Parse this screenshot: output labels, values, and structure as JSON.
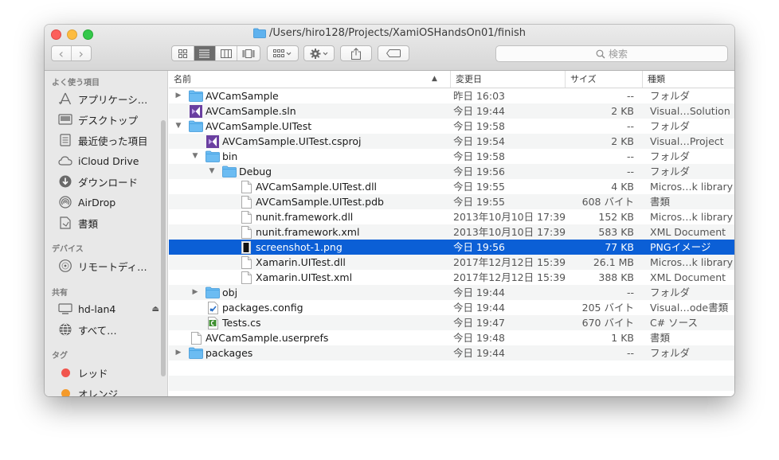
{
  "window": {
    "title": "/Users/hiro128/Projects/XamiOSHandsOn01/finish"
  },
  "toolbar": {
    "back": "‹",
    "forward": "›",
    "search_placeholder": "検索"
  },
  "sidebar": {
    "favorites_header": "よく使う項目",
    "favorites": [
      {
        "label": "アプリケーシ…",
        "icon": "applications-icon"
      },
      {
        "label": "デスクトップ",
        "icon": "desktop-icon"
      },
      {
        "label": "最近使った項目",
        "icon": "recents-icon"
      },
      {
        "label": "iCloud Drive",
        "icon": "cloud-icon"
      },
      {
        "label": "ダウンロード",
        "icon": "downloads-icon"
      },
      {
        "label": "AirDrop",
        "icon": "airdrop-icon"
      },
      {
        "label": "書類",
        "icon": "documents-icon"
      }
    ],
    "devices_header": "デバイス",
    "devices": [
      {
        "label": "リモートディ…",
        "icon": "disc-icon"
      }
    ],
    "shared_header": "共有",
    "shared": [
      {
        "label": "hd-lan4",
        "icon": "computer-icon"
      },
      {
        "label": "すべて…",
        "icon": "network-icon"
      }
    ],
    "tags_header": "タグ",
    "tags": [
      {
        "label": "レッド",
        "color": "#f1554d"
      },
      {
        "label": "オレンジ",
        "color": "#f49a2b"
      }
    ]
  },
  "columns": {
    "name": "名前",
    "date": "変更日",
    "size": "サイズ",
    "kind": "種類"
  },
  "files": [
    {
      "name": "AVCamSample",
      "date": "昨日 16:03",
      "size": "--",
      "kind": "フォルダ",
      "icon": "folder",
      "disclosure": "collapsed",
      "indent": 0
    },
    {
      "name": "AVCamSample.sln",
      "date": "今日 19:44",
      "size": "2 KB",
      "kind": "Visual…Solution",
      "icon": "vs",
      "disclosure": "none",
      "indent": 0
    },
    {
      "name": "AVCamSample.UITest",
      "date": "今日 19:58",
      "size": "--",
      "kind": "フォルダ",
      "icon": "folder",
      "disclosure": "expanded",
      "indent": 0
    },
    {
      "name": "AVCamSample.UITest.csproj",
      "date": "今日 19:54",
      "size": "2 KB",
      "kind": "Visual…Project",
      "icon": "vs",
      "disclosure": "none",
      "indent": 1
    },
    {
      "name": "bin",
      "date": "今日 19:58",
      "size": "--",
      "kind": "フォルダ",
      "icon": "folder",
      "disclosure": "expanded",
      "indent": 1
    },
    {
      "name": "Debug",
      "date": "今日 19:56",
      "size": "--",
      "kind": "フォルダ",
      "icon": "folder",
      "disclosure": "expanded",
      "indent": 2
    },
    {
      "name": "AVCamSample.UITest.dll",
      "date": "今日 19:55",
      "size": "4 KB",
      "kind": "Micros…k library",
      "icon": "doc",
      "disclosure": "none",
      "indent": 3
    },
    {
      "name": "AVCamSample.UITest.pdb",
      "date": "今日 19:55",
      "size": "608 バイト",
      "kind": "書類",
      "icon": "doc",
      "disclosure": "none",
      "indent": 3
    },
    {
      "name": "nunit.framework.dll",
      "date": "2013年10月10日 17:39",
      "size": "152 KB",
      "kind": "Micros…k library",
      "icon": "doc",
      "disclosure": "none",
      "indent": 3
    },
    {
      "name": "nunit.framework.xml",
      "date": "2013年10月10日 17:39",
      "size": "583 KB",
      "kind": "XML Document",
      "icon": "doc",
      "disclosure": "none",
      "indent": 3
    },
    {
      "name": "screenshot-1.png",
      "date": "今日 19:56",
      "size": "77 KB",
      "kind": "PNGイメージ",
      "icon": "image",
      "disclosure": "none",
      "indent": 3,
      "selected": true
    },
    {
      "name": "Xamarin.UITest.dll",
      "date": "2017年12月12日 15:39",
      "size": "26.1 MB",
      "kind": "Micros…k library",
      "icon": "doc",
      "disclosure": "none",
      "indent": 3
    },
    {
      "name": "Xamarin.UITest.xml",
      "date": "2017年12月12日 15:39",
      "size": "388 KB",
      "kind": "XML Document",
      "icon": "doc",
      "disclosure": "none",
      "indent": 3
    },
    {
      "name": "obj",
      "date": "今日 19:44",
      "size": "--",
      "kind": "フォルダ",
      "icon": "folder",
      "disclosure": "collapsed",
      "indent": 1
    },
    {
      "name": "packages.config",
      "date": "今日 19:44",
      "size": "205 バイト",
      "kind": "Visual…ode書類",
      "icon": "config",
      "disclosure": "none",
      "indent": 1
    },
    {
      "name": "Tests.cs",
      "date": "今日 19:47",
      "size": "670 バイト",
      "kind": "C# ソース",
      "icon": "cs",
      "disclosure": "none",
      "indent": 1
    },
    {
      "name": "AVCamSample.userprefs",
      "date": "今日 19:48",
      "size": "1 KB",
      "kind": "書類",
      "icon": "doc",
      "disclosure": "none",
      "indent": 0
    },
    {
      "name": "packages",
      "date": "今日 19:44",
      "size": "--",
      "kind": "フォルダ",
      "icon": "folder",
      "disclosure": "collapsed",
      "indent": 0
    }
  ]
}
